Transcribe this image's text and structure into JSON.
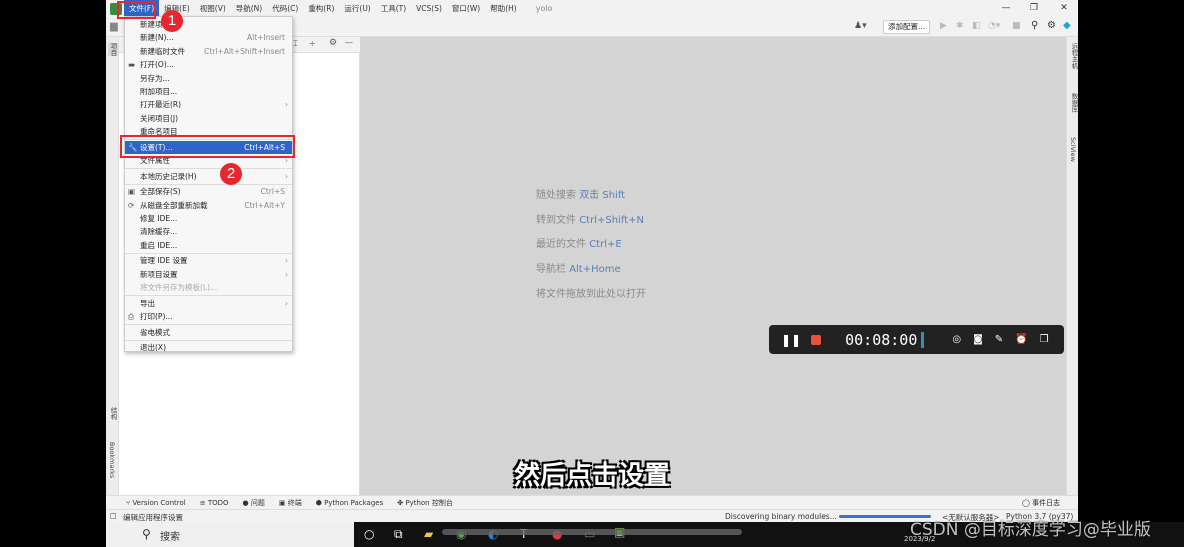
{
  "menubar": {
    "items": [
      "文件(F)",
      "编辑(E)",
      "视图(V)",
      "导航(N)",
      "代码(C)",
      "重构(R)",
      "运行(U)",
      "工具(T)",
      "VCS(S)",
      "窗口(W)",
      "帮助(H)"
    ],
    "project_title": "yolo"
  },
  "toolbar": {
    "add_config": "添加配置..."
  },
  "file_menu": [
    {
      "label": "新建项目"
    },
    {
      "label": "新建(N)...",
      "shortcut": "Alt+Insert"
    },
    {
      "label": "新建临时文件",
      "shortcut": "Ctrl+Alt+Shift+Insert"
    },
    {
      "label": "打开(O)...",
      "icon": "folder-icon"
    },
    {
      "label": "另存为..."
    },
    {
      "label": "附加项目..."
    },
    {
      "label": "打开最近(R)",
      "submenu": true
    },
    {
      "label": "关闭项目(J)"
    },
    {
      "label": "重命名项目"
    },
    {
      "separator": true
    },
    {
      "label": "设置(T)...",
      "shortcut": "Ctrl+Alt+S",
      "icon": "wrench-icon",
      "highlighted": true
    },
    {
      "label": "文件属性",
      "submenu": true
    },
    {
      "separator": true
    },
    {
      "label": "本地历史记录(H)",
      "submenu": true
    },
    {
      "separator": true
    },
    {
      "label": "全部保存(S)",
      "shortcut": "Ctrl+S",
      "icon": "save-icon"
    },
    {
      "label": "从磁盘全部重新加载",
      "shortcut": "Ctrl+Alt+Y",
      "icon": "reload-icon"
    },
    {
      "label": "修复 IDE..."
    },
    {
      "label": "清除缓存..."
    },
    {
      "label": "重启 IDE..."
    },
    {
      "separator": true
    },
    {
      "label": "管理 IDE 设置",
      "submenu": true
    },
    {
      "label": "新项目设置",
      "submenu": true
    },
    {
      "label": "将文件另存为模板(L)...",
      "disabled": true
    },
    {
      "separator": true
    },
    {
      "label": "导出",
      "submenu": true
    },
    {
      "label": "打印(P)...",
      "icon": "print-icon"
    },
    {
      "separator": true
    },
    {
      "label": "省电模式"
    },
    {
      "separator": true
    },
    {
      "label": "退出(X)"
    }
  ],
  "annotations": {
    "step1": "1",
    "step2": "2",
    "accent": "#e8262d"
  },
  "editor_hints": [
    {
      "text": "随处搜索",
      "key": "双击 Shift"
    },
    {
      "text": "转到文件",
      "key": "Ctrl+Shift+N"
    },
    {
      "text": "最近的文件",
      "key": "Ctrl+E"
    },
    {
      "text": "导航栏",
      "key": "Alt+Home"
    },
    {
      "text": "将文件拖放到此处以打开",
      "key": ""
    }
  ],
  "left_stripe": {
    "project": "项目",
    "structure": "结构",
    "bookmarks": "Bookmarks"
  },
  "right_stripe": {
    "remote": "远程主机",
    "database": "数据库",
    "sciview": "SciView"
  },
  "recorder": {
    "time": "00:08:00"
  },
  "bottom_tabs": [
    "Version Control",
    "TODO",
    "问题",
    "终端",
    "Python Packages",
    "Python 控制台"
  ],
  "event_log": "事件日志",
  "status": {
    "left": "编辑应用程序设置",
    "progress_text": "Discovering binary modules...",
    "server": "<无默认服务器>",
    "interpreter": "Python 3.7 (py37)"
  },
  "taskbar": {
    "search": "搜索",
    "date": "2023/9/2"
  },
  "subtitle": "然后点击设置",
  "watermark": "CSDN @目标深度学习@毕业版"
}
